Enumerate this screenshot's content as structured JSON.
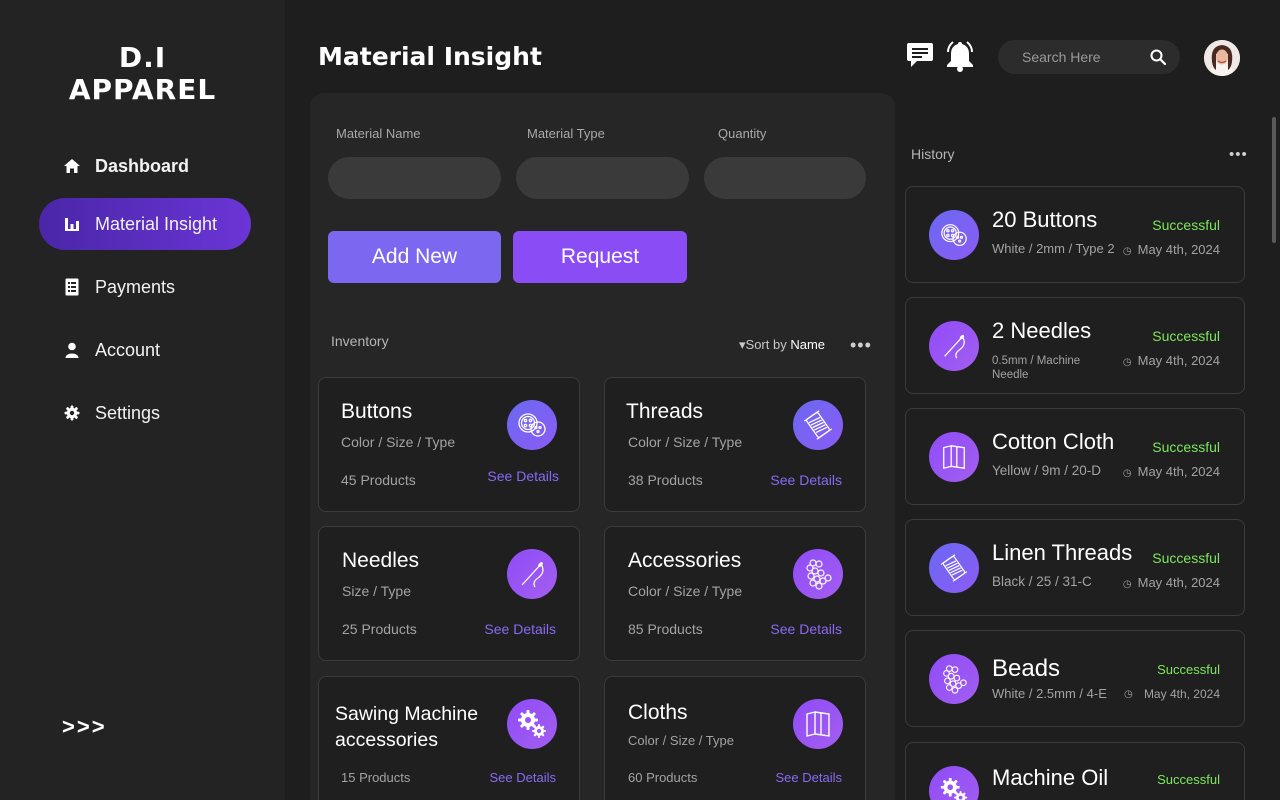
{
  "sidebar": {
    "logo_line1": "D.I",
    "logo_line2": "APPAREL",
    "items": [
      {
        "label": "Dashboard",
        "icon": "home-icon"
      },
      {
        "label": "Material Insight",
        "icon": "bar-chart-icon"
      },
      {
        "label": "Payments",
        "icon": "receipt-icon"
      },
      {
        "label": "Account",
        "icon": "user-icon"
      },
      {
        "label": "Settings",
        "icon": "gear-icon"
      }
    ],
    "expand_label": ">>>"
  },
  "header": {
    "title": "Material Insight",
    "search_placeholder": "Search Here",
    "icons": [
      "chat-icon",
      "bell-icon",
      "search-icon"
    ]
  },
  "form": {
    "material_name_label": "Material Name",
    "material_type_label": "Material Type",
    "quantity_label": "Quantity",
    "add_new_label": "Add New",
    "request_label": "Request"
  },
  "inventory": {
    "label": "Inventory",
    "sort_prefix": "▾Sort by",
    "sort_value": "Name",
    "more": "•••",
    "cards": [
      {
        "title": "Buttons",
        "sub": "Color / Size / Type",
        "count": "45 Products",
        "details": "See Details",
        "icon": "button-icon"
      },
      {
        "title": "Threads",
        "sub": "Color / Size / Type",
        "count": "38 Products",
        "details": "See Details",
        "icon": "thread-spool-icon"
      },
      {
        "title": "Needles",
        "sub": "Size / Type",
        "count": "25 Products",
        "details": "See Details",
        "icon": "needle-icon"
      },
      {
        "title": "Accessories",
        "sub": "Color / Size / Type",
        "count": "85 Products",
        "details": "See Details",
        "icon": "beads-icon"
      },
      {
        "title": "Sawing Machine accessories",
        "sub": "",
        "count": "15 Products",
        "details": "See Details",
        "icon": "gears-icon"
      },
      {
        "title": "Cloths",
        "sub": "Color / Size / Type",
        "count": "60 Products",
        "details": "See Details",
        "icon": "fabric-icon"
      }
    ]
  },
  "history": {
    "label": "History",
    "more": "•••",
    "items": [
      {
        "title": "20 Buttons",
        "sub": "White / 2mm / Type 2",
        "status": "Successful",
        "date": "May 4th, 2024",
        "icon": "button-icon"
      },
      {
        "title": "2 Needles",
        "sub": "0.5mm / Machine Needle",
        "status": "Successful",
        "date": "May 4th, 2024",
        "icon": "needle-icon"
      },
      {
        "title": "Cotton Cloth",
        "sub": "Yellow / 9m / 20-D",
        "status": "Successful",
        "date": "May 4th, 2024",
        "icon": "fabric-icon"
      },
      {
        "title": "Linen Threads",
        "sub": "Black / 25 / 31-C",
        "status": "Successful",
        "date": "May 4th, 2024",
        "icon": "thread-spool-icon"
      },
      {
        "title": "Beads",
        "sub": "White / 2.5mm / 4-E",
        "status": "Successful",
        "date": "May 4th, 2024",
        "icon": "beads-icon"
      },
      {
        "title": "Machine Oil",
        "sub": "",
        "status": "Successful",
        "date": "",
        "icon": "gears-icon"
      }
    ]
  },
  "colors": {
    "accent": "#8a4cf4",
    "success": "#7de65c",
    "link": "#8a6af5",
    "background": "#1e1e1e"
  }
}
